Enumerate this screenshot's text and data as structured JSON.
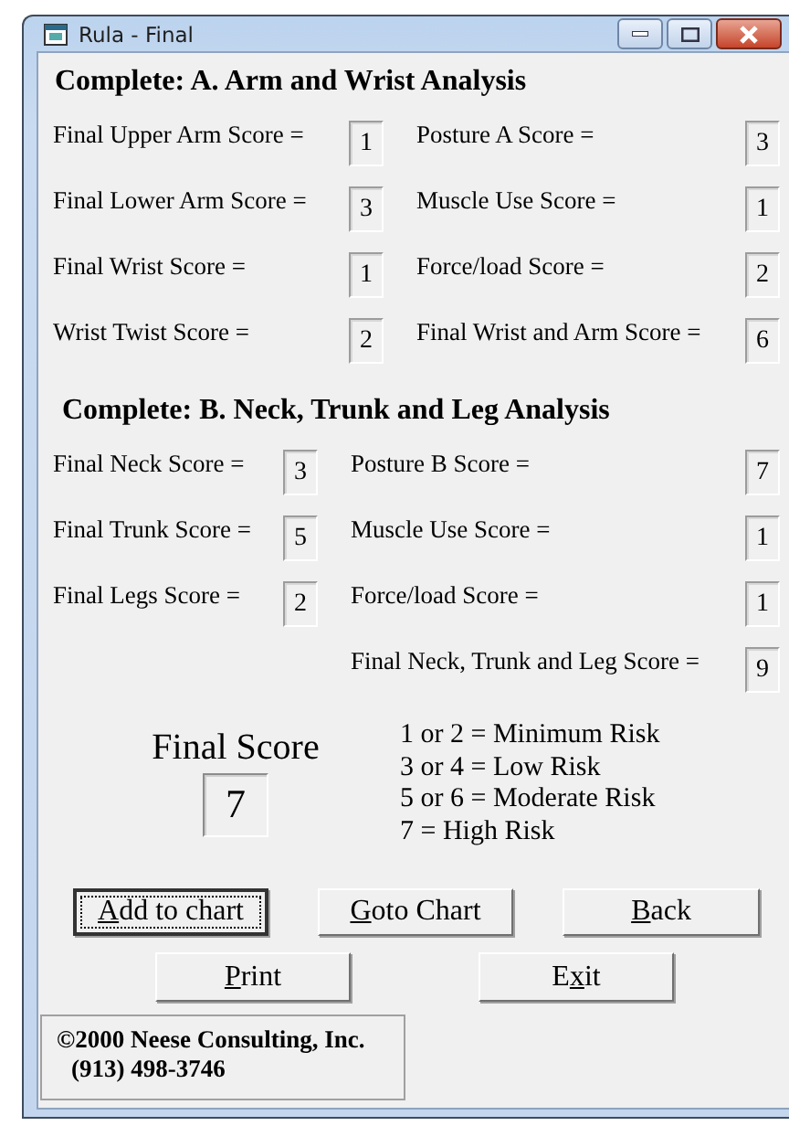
{
  "window": {
    "title": "Rula - Final"
  },
  "section_a": {
    "heading": "Complete: A. Arm and Wrist Analysis",
    "rows": [
      {
        "left_label": "Final Upper Arm Score =",
        "left_value": "1",
        "right_label": "Posture A Score =",
        "right_value": "3"
      },
      {
        "left_label": "Final Lower Arm Score =",
        "left_value": "3",
        "right_label": "Muscle Use Score =",
        "right_value": "1"
      },
      {
        "left_label": "Final Wrist Score =",
        "left_value": "1",
        "right_label": "Force/load Score =",
        "right_value": "2"
      },
      {
        "left_label": "Wrist Twist Score =",
        "left_value": "2",
        "right_label": "Final Wrist and Arm Score =",
        "right_value": "6"
      }
    ]
  },
  "section_b": {
    "heading": "Complete: B. Neck, Trunk and Leg Analysis",
    "rows": [
      {
        "left_label": "Final Neck Score =",
        "left_value": "3",
        "right_label": "Posture B Score =",
        "right_value": "7"
      },
      {
        "left_label": "Final Trunk Score =",
        "left_value": "5",
        "right_label": "Muscle Use Score =",
        "right_value": "1"
      },
      {
        "left_label": "Final Legs Score =",
        "left_value": "2",
        "right_label": "Force/load Score =",
        "right_value": "1"
      },
      {
        "right_label": "Final Neck, Trunk and Leg Score =",
        "right_value": "9"
      }
    ]
  },
  "final_score": {
    "label": "Final Score",
    "value": "7"
  },
  "legend": [
    "1 or 2 = Minimum Risk",
    "3 or 4 = Low Risk",
    "5 or 6 = Moderate Risk",
    "7 = High Risk"
  ],
  "button_rows": [
    [
      {
        "label_parts": [
          {
            "text": "A",
            "underlined": true
          },
          {
            "text": "dd to chart",
            "underlined": false
          }
        ],
        "focused": true
      },
      {
        "label_parts": [
          {
            "text": "G",
            "underlined": true
          },
          {
            "text": "oto Chart",
            "underlined": false
          }
        ],
        "focused": false
      },
      {
        "label_parts": [
          {
            "text": "B",
            "underlined": true
          },
          {
            "text": "ack",
            "underlined": false
          }
        ],
        "focused": false
      }
    ],
    [
      {
        "label_parts": [
          {
            "text": "P",
            "underlined": true
          },
          {
            "text": "rint",
            "underlined": false
          }
        ],
        "focused": false
      },
      {
        "label_parts": [
          {
            "text": "E",
            "underlined": false
          },
          {
            "text": "x",
            "underlined": true
          },
          {
            "text": "it",
            "underlined": false
          }
        ],
        "focused": false
      }
    ]
  ],
  "copyright": [
    "©2000 Neese Consulting, Inc.",
    "(913) 498-3746"
  ]
}
